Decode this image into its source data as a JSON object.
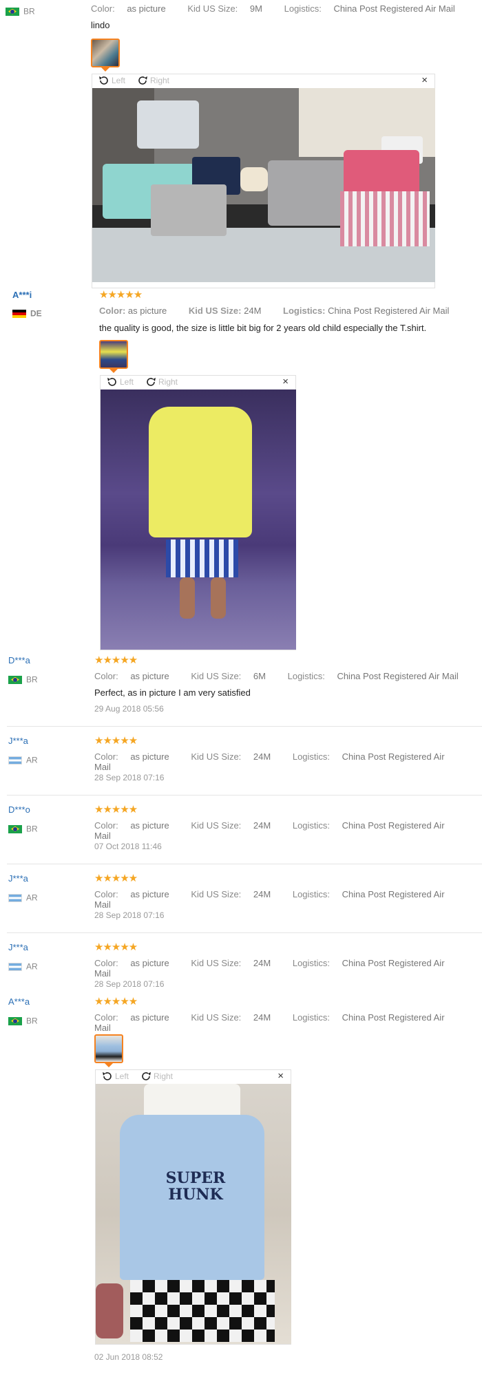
{
  "review0": {
    "country": "BR",
    "color_label": "Color:",
    "color_value": "as picture",
    "size_label": "Kid US Size:",
    "size_value": "9M",
    "logistics_label": "Logistics:",
    "logistics_value": "China Post Registered Air Mail",
    "text": "lindo",
    "viewer": {
      "left_label": "Left",
      "right_label": "Right",
      "close": "×"
    }
  },
  "review1": {
    "name": "A***i",
    "country": "DE",
    "stars": "★★★★★",
    "color_label": "Color:",
    "color_value": "as picture",
    "size_label": "Kid US Size:",
    "size_value": "24M",
    "logistics_label": "Logistics:",
    "logistics_value": "China Post Registered Air Mail",
    "text": "the quality is good, the size is little bit big for 2 years old child especially the T.shirt.",
    "viewer": {
      "left_label": "Left",
      "right_label": "Right",
      "close": "×"
    }
  },
  "review2": {
    "name": "D***a",
    "country": "BR",
    "stars": "★★★★★",
    "color_label": "Color:",
    "color_value": "as picture",
    "size_label": "Kid US Size:",
    "size_value": "6M",
    "logistics_label": "Logistics:",
    "logistics_value": "China Post Registered Air Mail",
    "text": "Perfect, as in picture I am very satisfied",
    "date": "29 Aug 2018 05:56"
  },
  "review3": {
    "name": "J***a",
    "country": "AR",
    "stars": "★★★★★",
    "color_label": "Color:",
    "color_value": "as picture",
    "size_label": "Kid US Size:",
    "size_value": "24M",
    "logistics_label": "Logistics:",
    "logistics_value": "China Post Registered Air Mail",
    "date": "28 Sep 2018 07:16"
  },
  "review4": {
    "name": "D***o",
    "country": "BR",
    "stars": "★★★★★",
    "color_label": "Color:",
    "color_value": "as picture",
    "size_label": "Kid US Size:",
    "size_value": "24M",
    "logistics_label": "Logistics:",
    "logistics_value": "China Post Registered Air Mail",
    "date": "07 Oct 2018 11:46"
  },
  "review5": {
    "name": "J***a",
    "country": "AR",
    "stars": "★★★★★",
    "color_label": "Color:",
    "color_value": "as picture",
    "size_label": "Kid US Size:",
    "size_value": "24M",
    "logistics_label": "Logistics:",
    "logistics_value": "China Post Registered Air Mail",
    "date": "28 Sep 2018 07:16"
  },
  "review6": {
    "name": "J***a",
    "country": "AR",
    "stars": "★★★★★",
    "color_label": "Color:",
    "color_value": "as picture",
    "size_label": "Kid US Size:",
    "size_value": "24M",
    "logistics_label": "Logistics:",
    "logistics_value": "China Post Registered Air Mail",
    "date": "28 Sep 2018 07:16"
  },
  "review7": {
    "name": "A***a",
    "country": "BR",
    "stars": "★★★★★",
    "color_label": "Color:",
    "color_value": "as picture",
    "size_label": "Kid US Size:",
    "size_value": "24M",
    "logistics_label": "Logistics:",
    "logistics_value": "China Post Registered Air Mail",
    "date": "02 Jun 2018 08:52",
    "viewer": {
      "left_label": "Left",
      "right_label": "Right",
      "close": "×"
    }
  },
  "photo3_text": {
    "line1": "SUPER",
    "line2": "HUNK"
  },
  "colors": {
    "accent": "#f58220",
    "name": "#2b6fb5",
    "star": "#f5a623"
  }
}
